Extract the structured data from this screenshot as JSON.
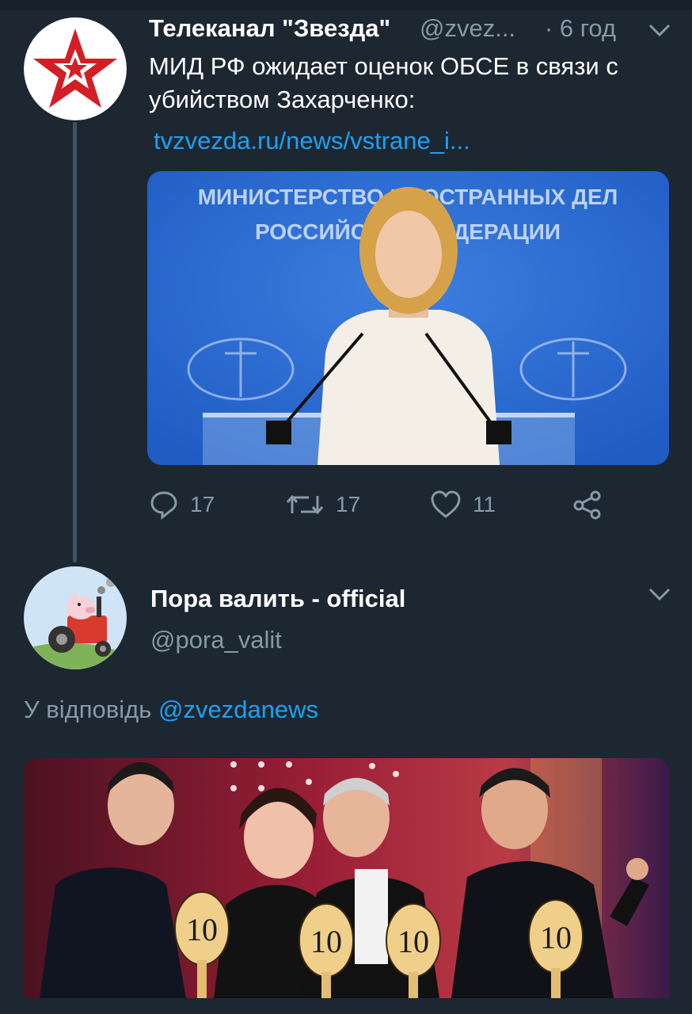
{
  "colors": {
    "background": "#1c2732",
    "text_primary": "#ffffff",
    "text_secondary": "#8899a6",
    "link": "#1da1f2",
    "thread_line": "#3d5466"
  },
  "tweets": [
    {
      "author_name": "Телеканал \"Звезда\"",
      "author_handle": "@zvez...",
      "time": "· 6 год",
      "menu_icon": "chevron-down-icon",
      "text": "МИД РФ ожидает оценок ОБСЕ в связи с убийством Захарченко:",
      "link": "tvzvezda.ru/news/vstrane_i...",
      "media_text_line1": "МИНИСТЕРСТВО ИНОСТРАННЫХ ДЕЛ",
      "media_text_line2": "РОССИЙСКОЙ ФЕДЕРАЦИИ",
      "actions": {
        "reply": {
          "icon": "reply-icon",
          "count": "17"
        },
        "retweet": {
          "icon": "retweet-icon",
          "count": "17"
        },
        "like": {
          "icon": "heart-icon",
          "count": "11"
        },
        "share": {
          "icon": "share-icon"
        }
      }
    },
    {
      "author_name": "Пора валить - official",
      "author_handle": "@pora_valit",
      "menu_icon": "chevron-down-icon",
      "reply_prefix": "У відповідь",
      "reply_mention": "@zvezdanews",
      "media_scores": [
        "10",
        "10",
        "10",
        "10"
      ]
    }
  ]
}
